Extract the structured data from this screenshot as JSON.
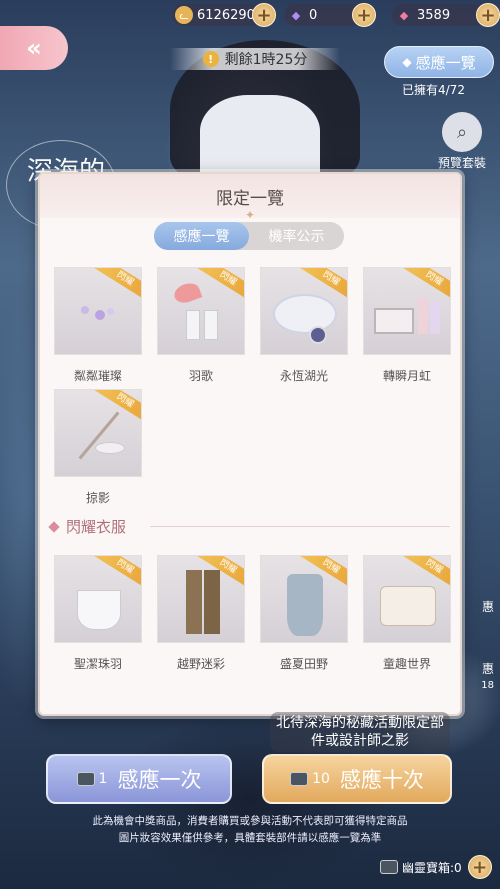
{
  "currencies": [
    {
      "icon": "cat-coin-icon",
      "value": "6126290"
    },
    {
      "icon": "purple-diamond-icon",
      "value": "0"
    },
    {
      "icon": "pink-diamond-icon",
      "value": "3589"
    }
  ],
  "timer": {
    "text": "剩餘1時25分"
  },
  "induction_top": {
    "label": "感應一覽",
    "owned": "已擁有4/72"
  },
  "preview": {
    "label": "預覽套裝"
  },
  "bg_title": "深海的",
  "modal": {
    "title": "限定一覽",
    "tabs": [
      "感應一覽",
      "機率公示"
    ],
    "badge": "閃耀",
    "items": [
      {
        "label": "粼粼璀璨"
      },
      {
        "label": "羽歌"
      },
      {
        "label": "永恆湖光"
      },
      {
        "label": "轉瞬月虹"
      },
      {
        "label": "掠影"
      }
    ],
    "section_title": "閃耀衣服",
    "clothes": [
      {
        "label": "聖潔珠羽"
      },
      {
        "label": "越野迷彩"
      },
      {
        "label": "盛夏田野"
      },
      {
        "label": "童趣世界"
      }
    ]
  },
  "bottom": {
    "caption_line1": "北待深海的秘藏活動限定部",
    "caption_line2": "件或設計師之影",
    "one_cost": "1",
    "one_label": "感應一次",
    "ten_cost": "10",
    "ten_label": "感應十次",
    "disclaimer_line1": "此為機會中獎商品，消費者購買或參與活動不代表即可獲得特定商品",
    "disclaimer_line2": "圖片妝容效果僅供參考，具體套裝部件請以感應一覽為準",
    "ghost_chest": "幽靈寶箱:0"
  },
  "side_labels": [
    "惠",
    "惠",
    "18"
  ]
}
